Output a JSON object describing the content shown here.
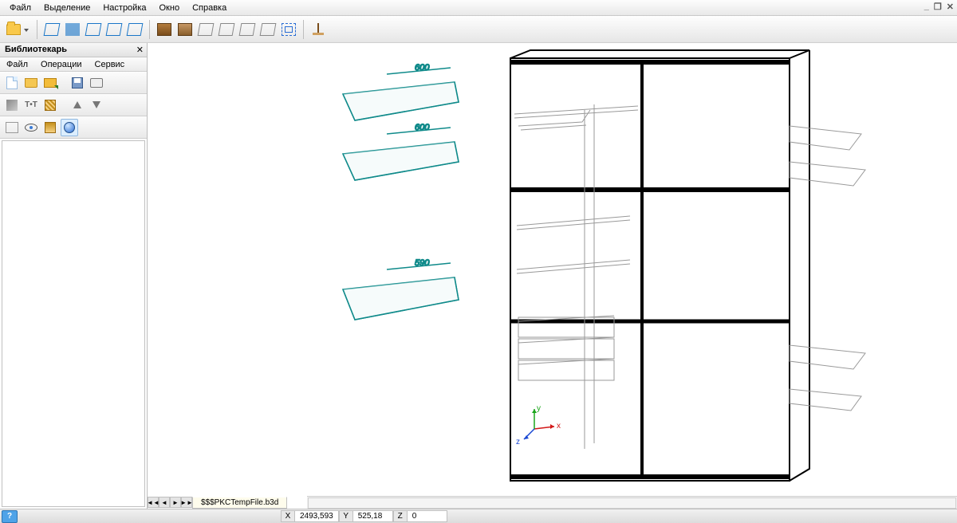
{
  "menu": {
    "file": "Файл",
    "selection": "Выделение",
    "settings": "Настройка",
    "window": "Окно",
    "help": "Справка"
  },
  "window_controls": {
    "minimize": "_",
    "restore": "❐",
    "close": "✕"
  },
  "panel": {
    "title": "Библиотекарь",
    "close": "✕",
    "menu": {
      "file": "Файл",
      "operations": "Операции",
      "service": "Сервис"
    }
  },
  "tab": {
    "name": "$$$PKCTempFile.b3d"
  },
  "dimensions": {
    "d1": "600",
    "d2": "600",
    "d3": "590"
  },
  "axis": {
    "x": "x",
    "y": "y",
    "z": "z"
  },
  "status": {
    "help": "?",
    "x_label": "X",
    "x_val": "2493,593",
    "y_label": "Y",
    "y_val": "525,18",
    "z_label": "Z",
    "z_val": "0"
  }
}
